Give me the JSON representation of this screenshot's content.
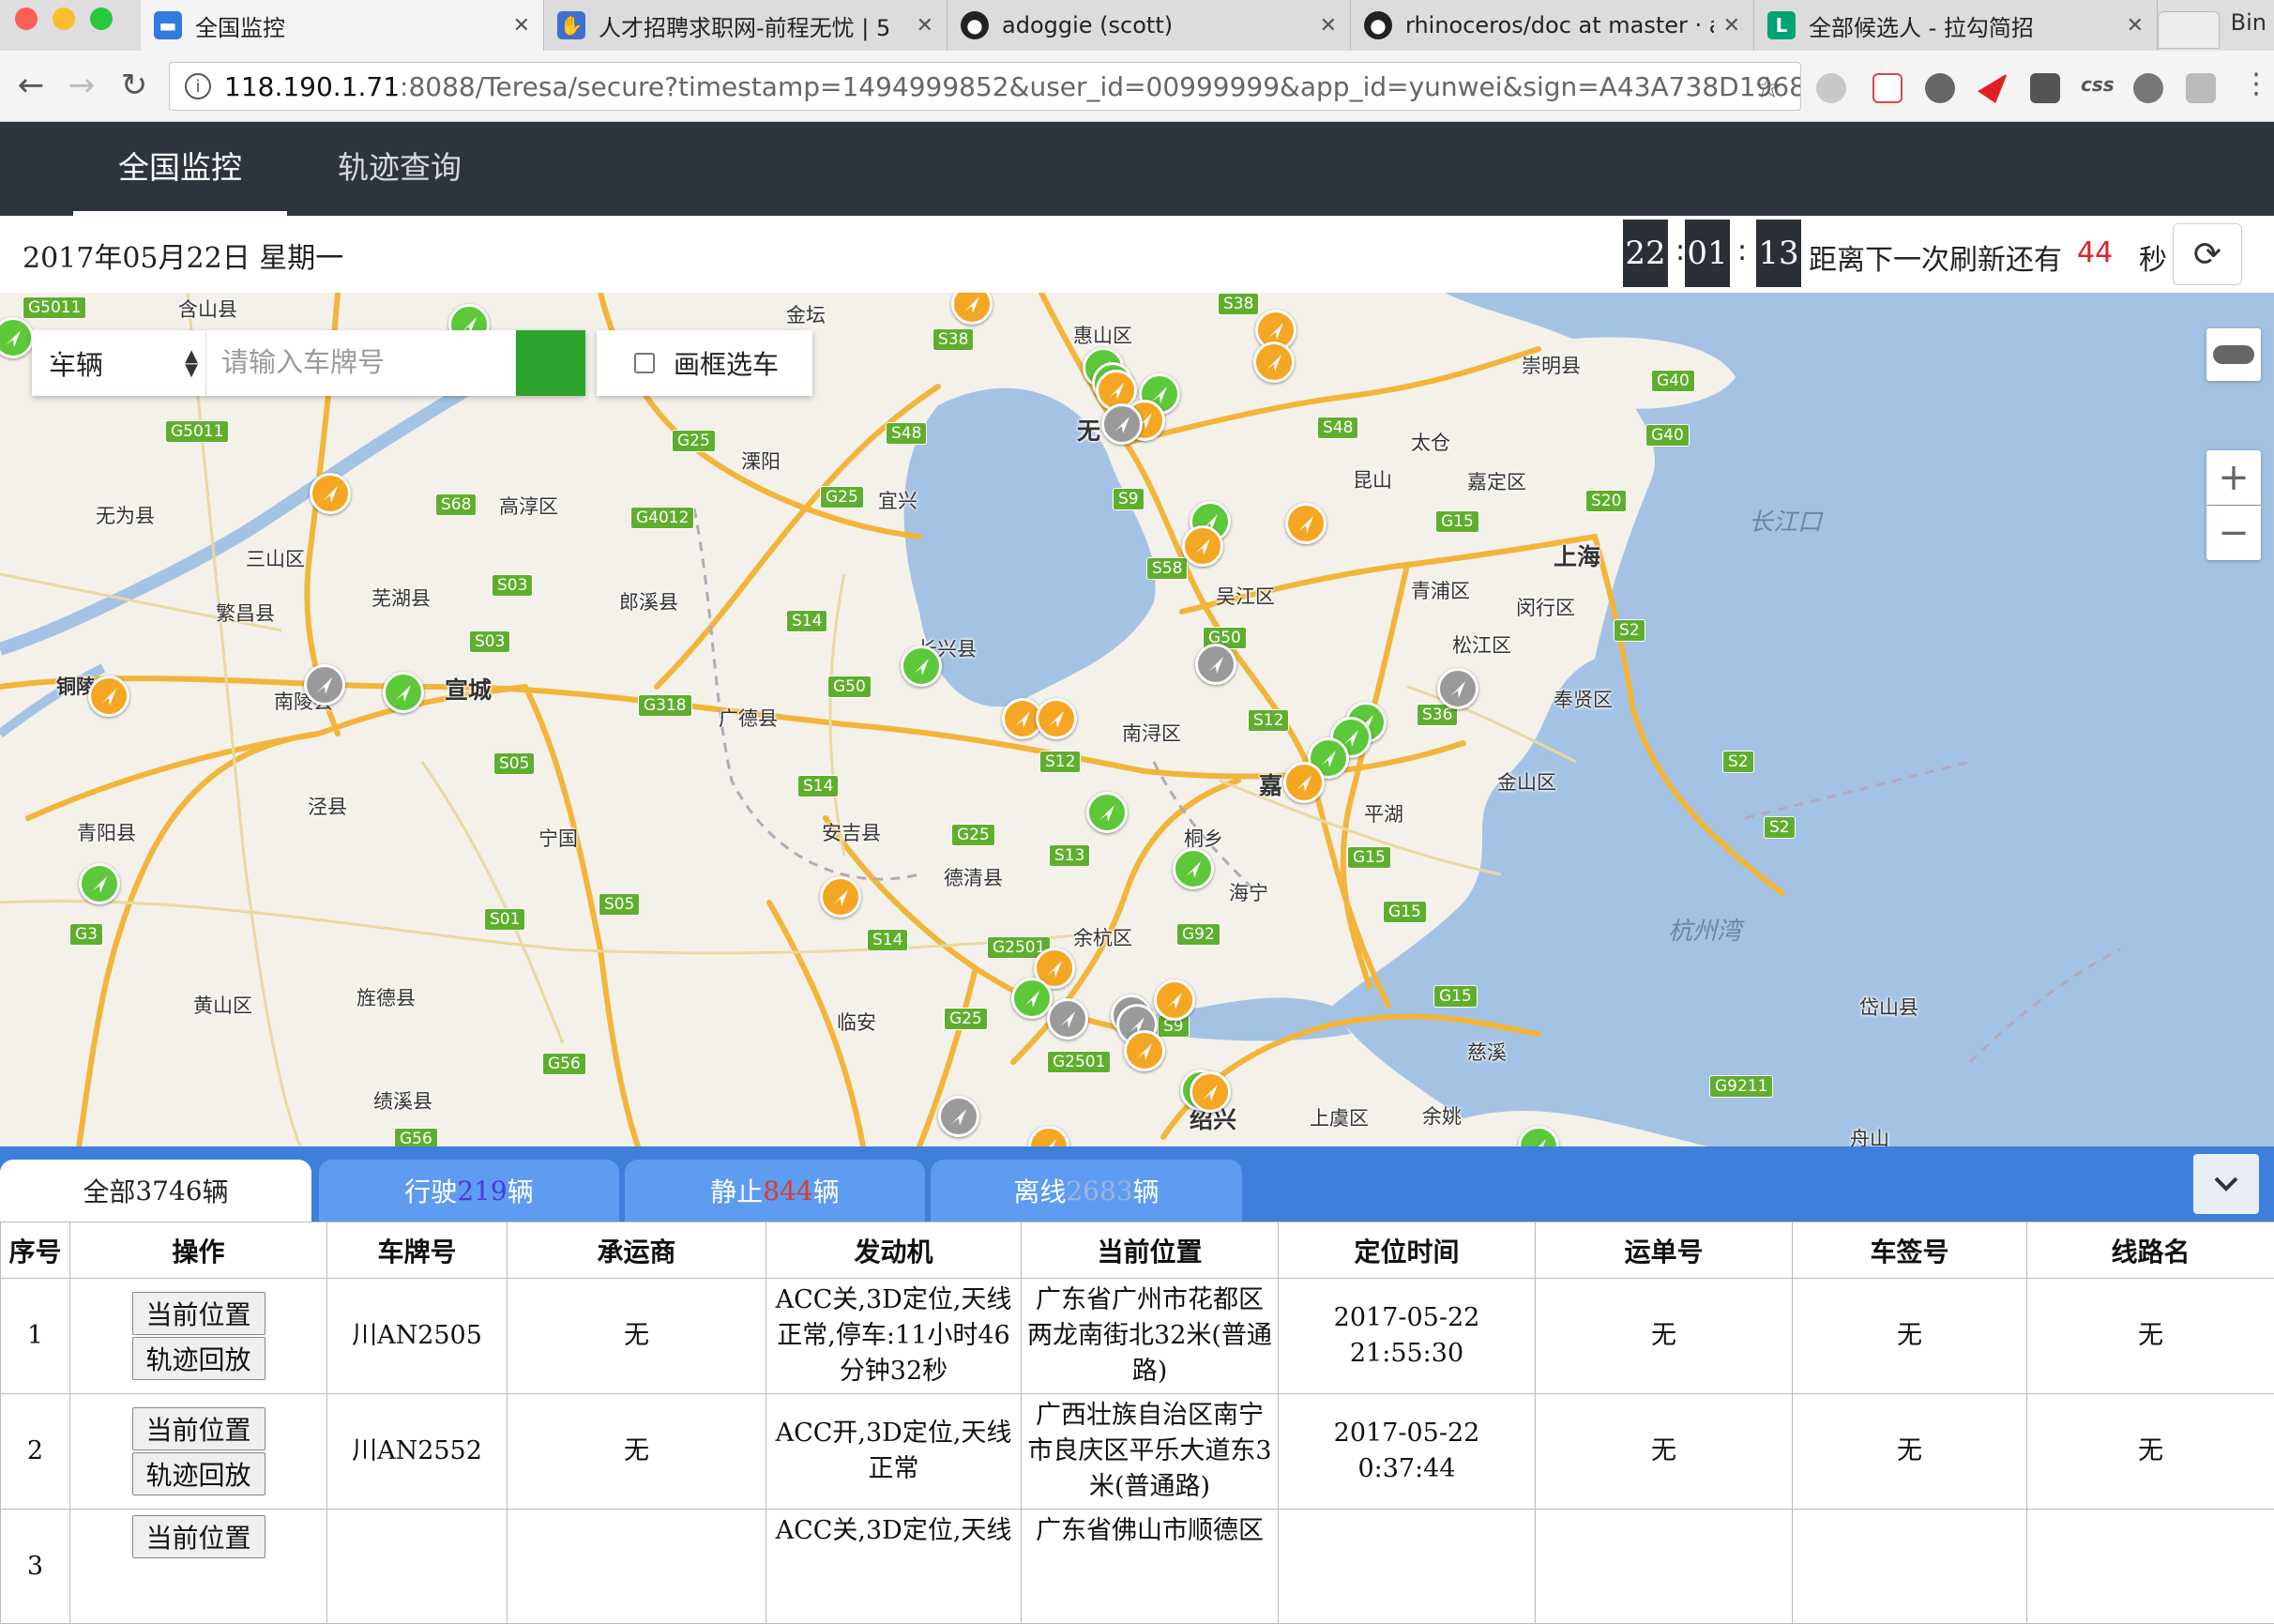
{
  "browser": {
    "tabs": [
      {
        "title": "全国监控",
        "active": true
      },
      {
        "title": "人才招聘求职网-前程无忧 | 5",
        "active": false
      },
      {
        "title": "adoggie (scott)",
        "active": false
      },
      {
        "title": "rhinoceros/doc at master · a",
        "active": false
      },
      {
        "title": "全部候选人 - 拉勾简招",
        "active": false
      }
    ],
    "profile": "Bin",
    "url_host": "118.190.1.71",
    "url_rest": ":8088/Teresa/secure?timestamp=1494999852&user_id=00999999&app_id=yunwei&sign=A43A738D1968..."
  },
  "nav": {
    "items": [
      "全国监控",
      "轨迹查询"
    ]
  },
  "infobar": {
    "date": "2017年05月22日 星期一",
    "clock": [
      "22",
      "01",
      "13"
    ],
    "countdown_label": "距离下一次刷新还有",
    "countdown_value": "44",
    "countdown_unit": "秒"
  },
  "search": {
    "type_value": "车辆",
    "placeholder": "请输入车牌号",
    "box_select_label": "画框选车"
  },
  "map": {
    "place_labels": [
      "含山县",
      "无为县",
      "三山区",
      "繁昌县",
      "芜湖县",
      "铜陵",
      "南陵县",
      "宣城",
      "泾县",
      "青阳县",
      "黄山区",
      "旌德县",
      "绩溪县",
      "宁国",
      "溧阳",
      "高淳区",
      "郎溪县",
      "广德县",
      "安吉县",
      "德清县",
      "临安",
      "余杭区",
      "宜兴",
      "长兴县",
      "南浔区",
      "吴江区",
      "嘉",
      "桐乡",
      "海宁",
      "平湖",
      "金山区",
      "奉贤区",
      "松江区",
      "闵行区",
      "青浦区",
      "上海",
      "嘉定区",
      "昆山",
      "太仓",
      "崇明县",
      "惠山区",
      "绍兴",
      "上虞区",
      "余姚",
      "慈溪",
      "舟山",
      "岱山县",
      "金坛",
      "无"
    ],
    "sea_labels": [
      "长江口",
      "杭州湾"
    ],
    "road_shields": [
      "G5011",
      "G5011",
      "S68",
      "S03",
      "S03",
      "G318",
      "S05",
      "G3",
      "S01",
      "S05",
      "G56",
      "G56",
      "S38",
      "G25",
      "S48",
      "G25",
      "G4012",
      "S14",
      "S14",
      "G50",
      "S12",
      "G25",
      "S13",
      "S14",
      "G2501",
      "G25",
      "G2501",
      "G92",
      "S9",
      "S9",
      "S58",
      "S9",
      "G50",
      "S12",
      "S36",
      "G15",
      "G15",
      "G15",
      "G15",
      "S2",
      "S2",
      "S20",
      "S48",
      "G40",
      "G40",
      "S38",
      "G9211",
      "S2"
    ]
  },
  "status_tabs": [
    {
      "prefix": "全部",
      "count": "3746",
      "suffix": "辆",
      "count_color": "#222222"
    },
    {
      "prefix": "行驶",
      "count": "219",
      "suffix": "辆",
      "count_color": "#4a3ad8"
    },
    {
      "prefix": "静止",
      "count": "844",
      "suffix": "辆",
      "count_color": "#e03a2e"
    },
    {
      "prefix": "离线",
      "count": "2683",
      "suffix": "辆",
      "count_color": "#9ab4dc"
    }
  ],
  "table": {
    "headers": [
      "序号",
      "操作",
      "车牌号",
      "承运商",
      "发动机",
      "当前位置",
      "定位时间",
      "运单号",
      "车签号",
      "线路名"
    ],
    "action_labels": [
      "当前位置",
      "轨迹回放"
    ],
    "rows": [
      {
        "no": "1",
        "plate": "川AN2505",
        "carrier": "无",
        "engine": "ACC关,3D定位,天线正常,停车:11小时46分钟32秒",
        "location": "广东省广州市花都区两龙南街北32米(普通路)",
        "time": "2017-05-22 21:55:30",
        "waybill": "无",
        "tag": "无",
        "route": "无"
      },
      {
        "no": "2",
        "plate": "川AN2552",
        "carrier": "无",
        "engine": "ACC开,3D定位,天线正常",
        "location": "广西壮族自治区南宁市良庆区平乐大道东3米(普通路)",
        "time": "2017-05-22 0:37:44",
        "waybill": "无",
        "tag": "无",
        "route": "无"
      },
      {
        "no": "3",
        "plate": "",
        "carrier": "",
        "engine": "ACC关,3D定位,天线",
        "location": "广东省佛山市顺德区",
        "time": "",
        "waybill": "",
        "tag": "",
        "route": ""
      }
    ]
  },
  "colors": {
    "nav_bg": "#2e343e",
    "tab_bar": "#3f7fdc",
    "search_btn": "#2da42d",
    "marker_moving": "#5cc83a",
    "marker_stopped": "#f5a623",
    "marker_offline": "#9a9a9a"
  }
}
